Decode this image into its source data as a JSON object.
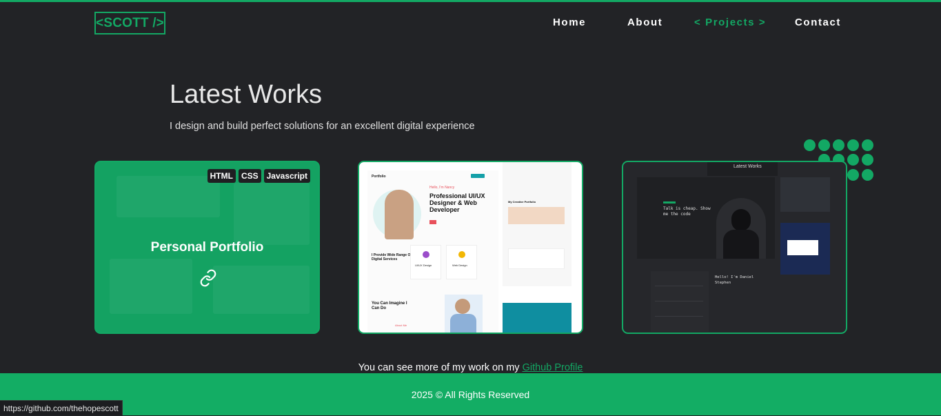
{
  "nav": {
    "logo": "<SCOTT />",
    "links": [
      "Home",
      "About",
      "< Projects >",
      "Contact"
    ]
  },
  "hero": {
    "title": "Latest Works",
    "subtitle": "I design and build perfect solutions for an excellent digital experience"
  },
  "cards": [
    {
      "title": "Personal Portfolio",
      "tags": [
        "HTML",
        "CSS",
        "Javascript"
      ]
    },
    {
      "preview": {
        "brand": "Portfolio",
        "greeting": "Hello, I'm Nancy",
        "headline": "Professional UI/UX Designer & Web Developer",
        "section1": "I Provide Wide Range Of Digital Services",
        "services": [
          "UI/UX Design",
          "Web Design"
        ],
        "section2": "My Creative Portfolio",
        "section3": "You Can Imagine I Can Do",
        "about": "About Me"
      }
    },
    {
      "preview": {
        "header": "Latest Works",
        "tagline": "Talk is cheap. Show me the code",
        "greeting": "Hello! I'm Daniel Stephen"
      }
    }
  ],
  "more": {
    "text": "You can see more of my work on my ",
    "link": "Github Profile"
  },
  "footer": "2025 © All Rights Reserved",
  "status_url": "https://github.com/thehopescott",
  "colors": {
    "accent": "#13a864",
    "background": "#222326",
    "footer": "#13ad64"
  }
}
